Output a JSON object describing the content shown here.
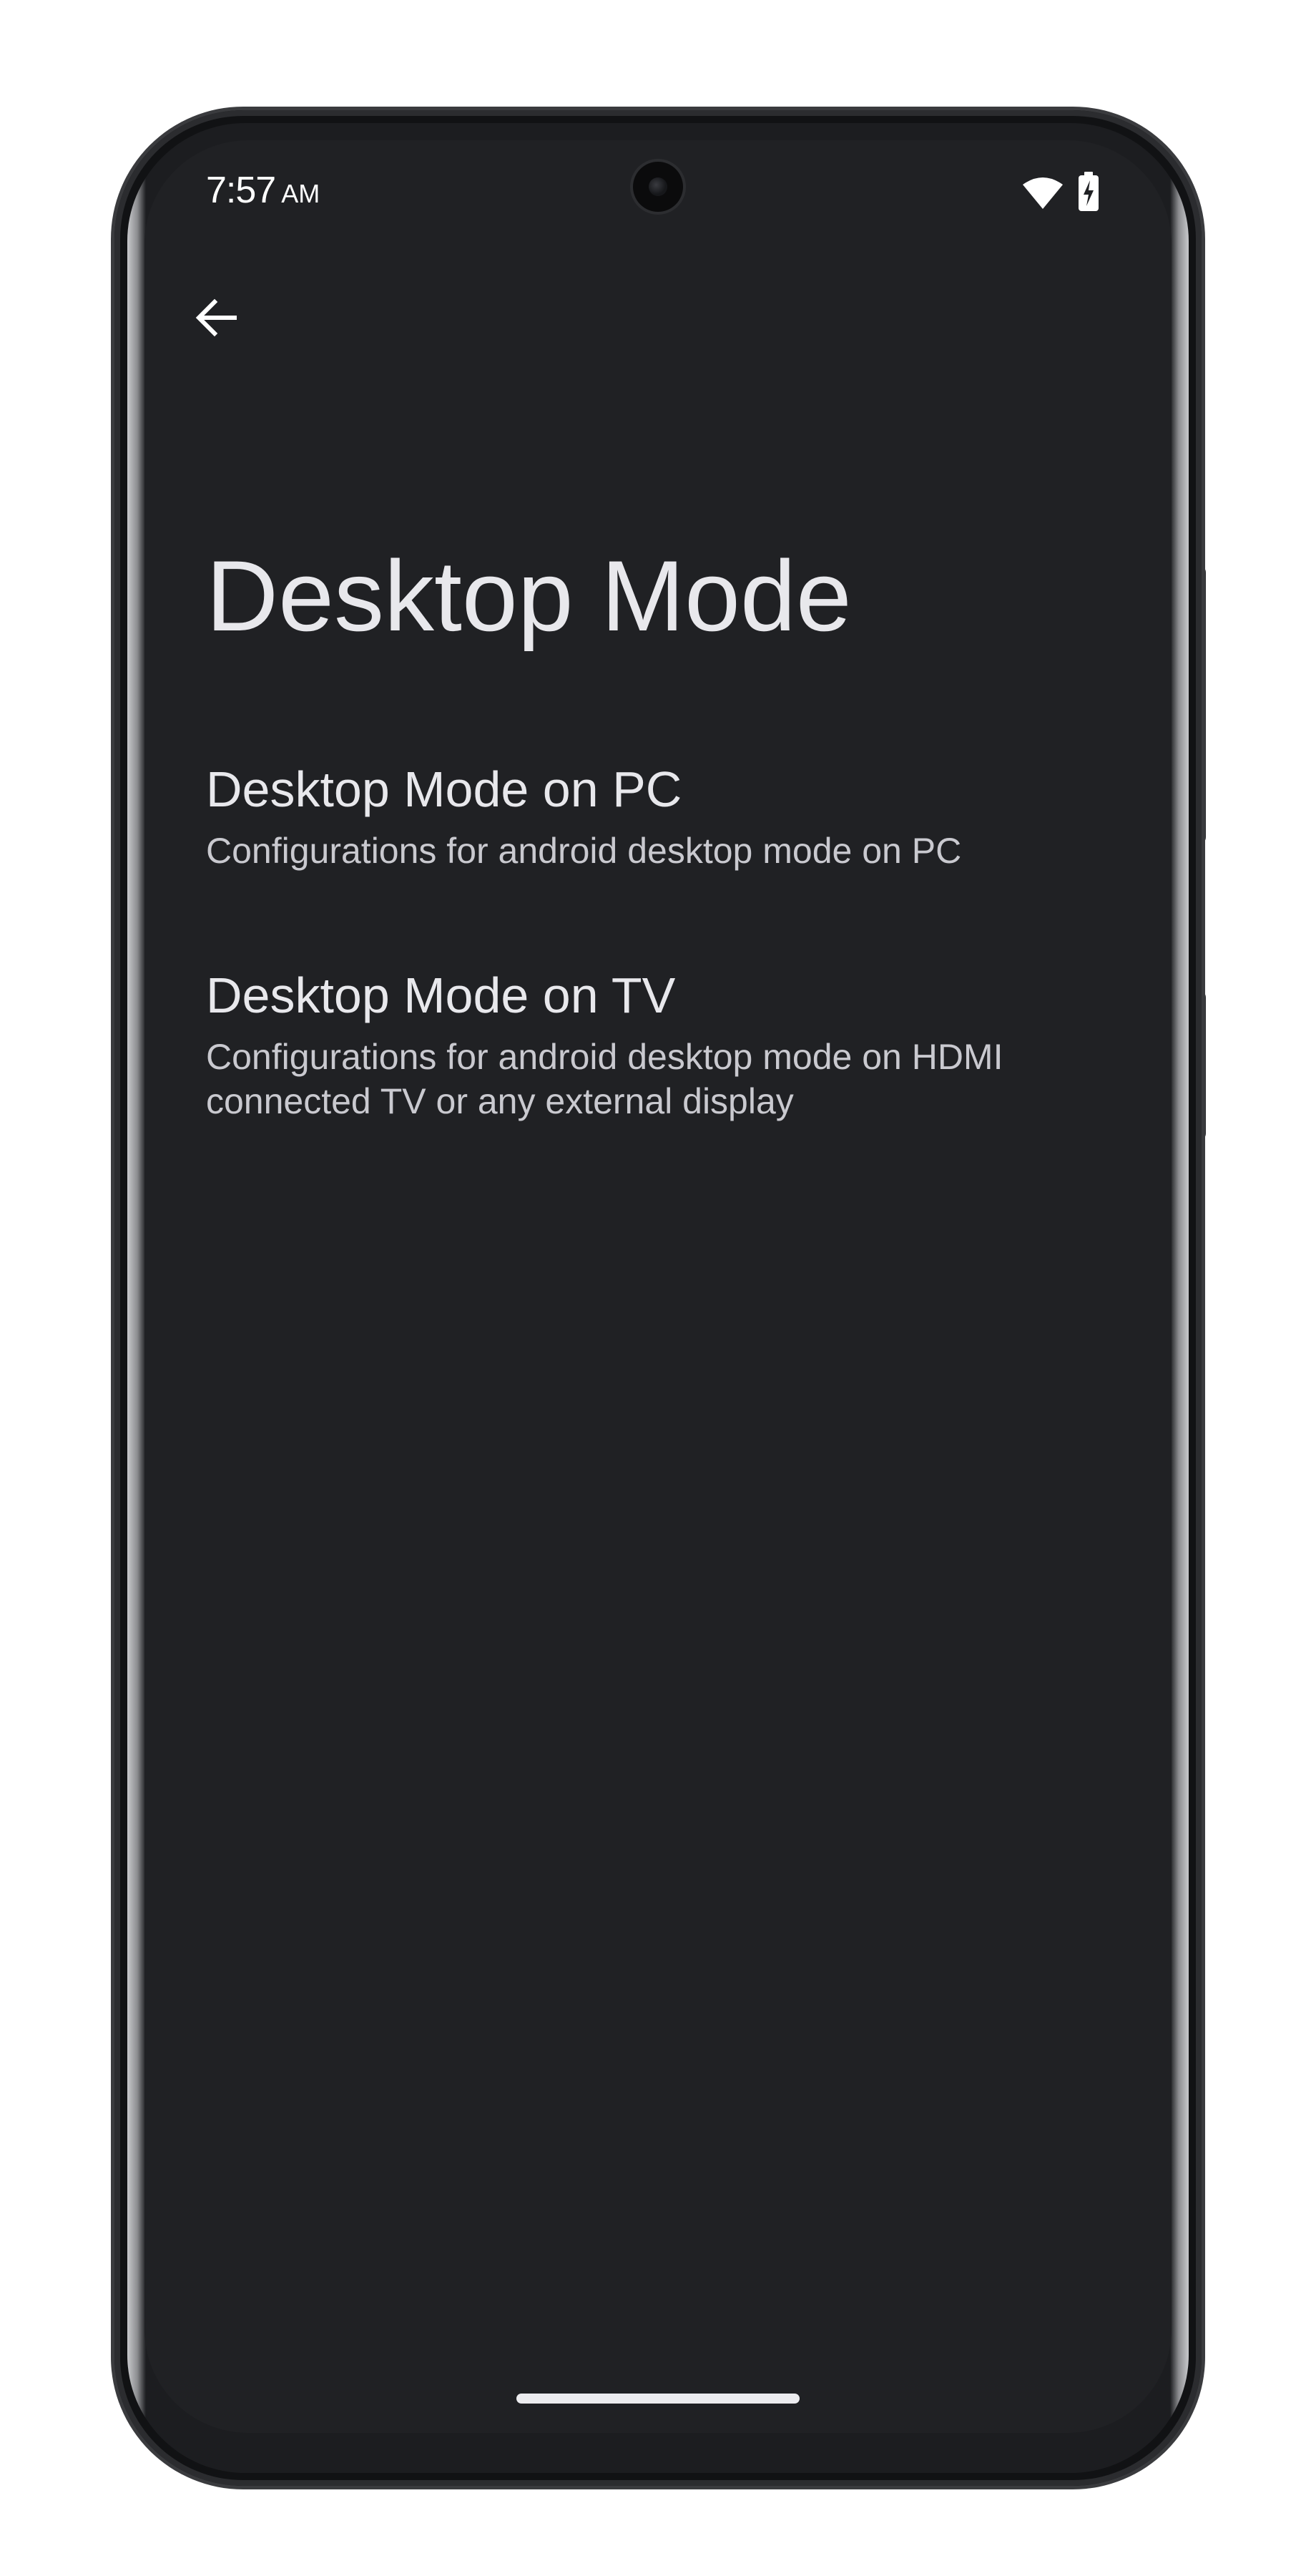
{
  "status_bar": {
    "time": "7:57",
    "ampm": "AM",
    "icons": [
      "wifi-icon",
      "battery-charging-icon"
    ]
  },
  "app_bar": {
    "back_icon": "arrow-left-icon"
  },
  "page": {
    "title": "Desktop Mode"
  },
  "preferences": [
    {
      "title": "Desktop Mode on PC",
      "summary": "Configurations for android desktop mode on PC"
    },
    {
      "title": "Desktop Mode on TV",
      "summary": "Configurations for android desktop mode on HDMI connected TV or any external display"
    }
  ],
  "colors": {
    "background": "#202124",
    "text_primary": "#e8e8ec",
    "text_secondary": "#c9c9cf"
  }
}
